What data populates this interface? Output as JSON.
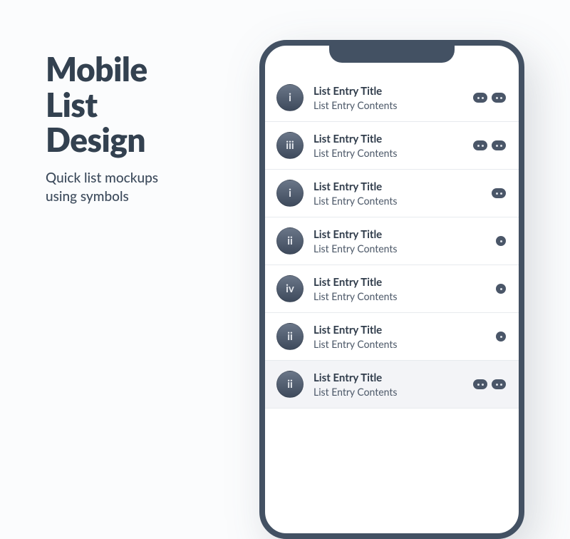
{
  "headline": {
    "title_l1": "Mobile",
    "title_l2": "List",
    "title_l3": "Design",
    "sub_l1": "Quick list mockups",
    "sub_l2": "using symbols"
  },
  "colors": {
    "frame": "#435163",
    "text": "#334150"
  },
  "rows": [
    {
      "badge": "i",
      "title": "List Entry Title",
      "subtitle": "List Entry Contents",
      "dots": [
        2,
        2
      ],
      "selected": false
    },
    {
      "badge": "iii",
      "title": "List Entry Title",
      "subtitle": "List Entry Contents",
      "dots": [
        2,
        2
      ],
      "selected": false
    },
    {
      "badge": "i",
      "title": "List Entry Title",
      "subtitle": "List Entry Contents",
      "dots": [
        2
      ],
      "selected": false
    },
    {
      "badge": "ii",
      "title": "List Entry Title",
      "subtitle": "List Entry Contents",
      "dots": [
        1
      ],
      "selected": false
    },
    {
      "badge": "iv",
      "title": "List Entry Title",
      "subtitle": "List Entry Contents",
      "dots": [
        1
      ],
      "selected": false
    },
    {
      "badge": "ii",
      "title": "List Entry Title",
      "subtitle": "List Entry Contents",
      "dots": [
        1
      ],
      "selected": false
    },
    {
      "badge": "ii",
      "title": "List Entry Title",
      "subtitle": "List Entry Contents",
      "dots": [
        2,
        2
      ],
      "selected": true
    }
  ]
}
